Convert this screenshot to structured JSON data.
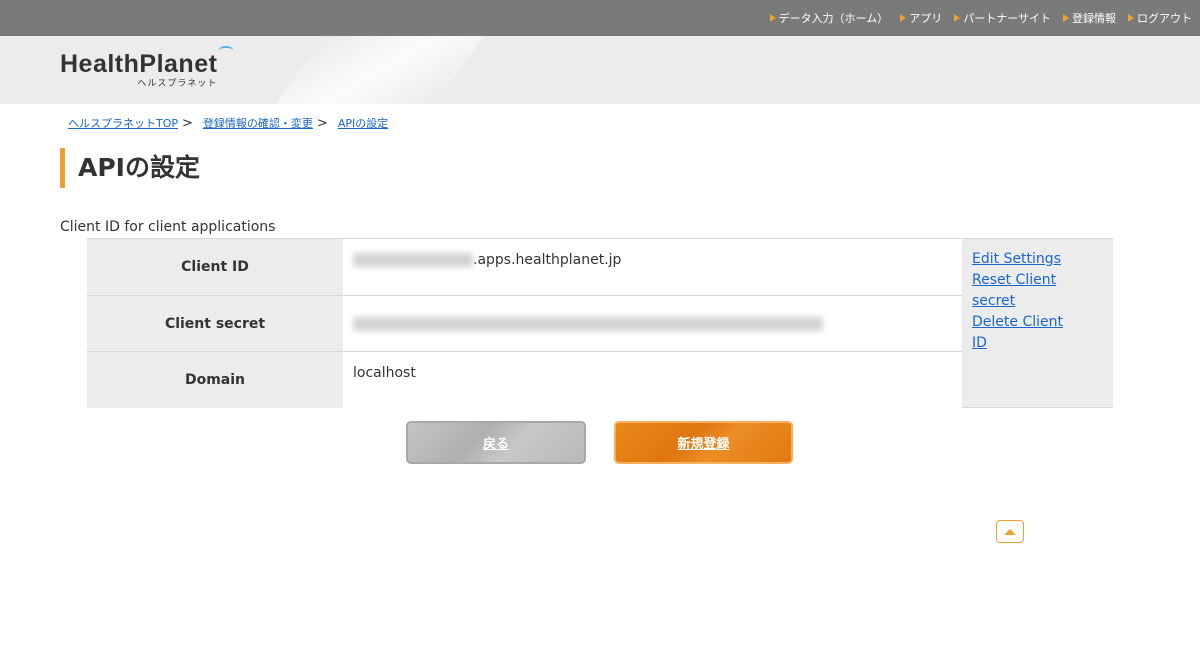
{
  "top_nav": [
    {
      "label": "データ入力（ホーム）"
    },
    {
      "label": "アプリ"
    },
    {
      "label": "パートナーサイト"
    },
    {
      "label": "登録情報"
    },
    {
      "label": "ログアウト"
    }
  ],
  "logo": {
    "main": "HealthPlanet",
    "sub": "ヘルスプラネット"
  },
  "breadcrumb": [
    {
      "label": "ヘルスプラネットTOP"
    },
    {
      "label": "登録情報の確認・変更"
    },
    {
      "label": "APIの設定"
    }
  ],
  "breadcrumb_sep": ">",
  "page_title": "APIの設定",
  "section_label": "Client ID for client applications",
  "table": {
    "rows": [
      {
        "header": "Client ID",
        "value": ".apps.healthplanet.jp"
      },
      {
        "header": "Client secret",
        "value": ""
      },
      {
        "header": "Domain",
        "value": "localhost"
      }
    ],
    "actions": [
      {
        "label": "Edit Settings"
      },
      {
        "label": "Reset Client secret"
      },
      {
        "label": "Delete Client ID"
      }
    ]
  },
  "buttons": {
    "back": "戻る",
    "new": "新規登録"
  },
  "colors": {
    "accent": "#f0a030",
    "link": "#1a66cc",
    "topbar": "#7a7a7a",
    "primary_button": "#e07a12"
  }
}
